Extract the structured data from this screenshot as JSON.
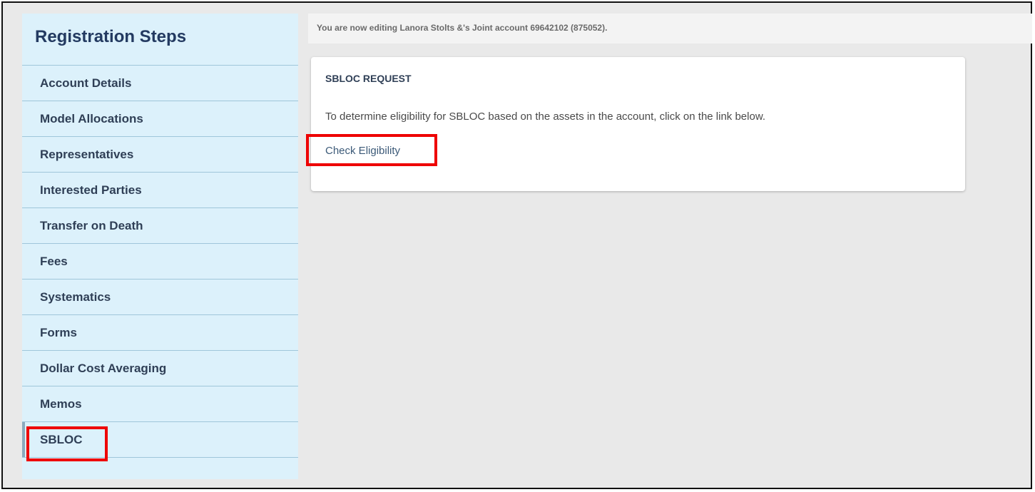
{
  "sidebar": {
    "title": "Registration Steps",
    "steps": [
      {
        "label": "Account Details"
      },
      {
        "label": "Model Allocations"
      },
      {
        "label": "Representatives"
      },
      {
        "label": "Interested Parties"
      },
      {
        "label": "Transfer on Death"
      },
      {
        "label": "Fees"
      },
      {
        "label": "Systematics"
      },
      {
        "label": "Forms"
      },
      {
        "label": "Dollar Cost Averaging"
      },
      {
        "label": "Memos"
      },
      {
        "label": "SBLOC"
      }
    ],
    "active_step": "SBLOC"
  },
  "notice": {
    "text": "You are now editing Lanora Stolts &'s Joint account 69642102 (875052)."
  },
  "card": {
    "title": "SBLOC REQUEST",
    "description": "To determine eligibility for SBLOC based on the assets in the account, click on the link below.",
    "link_label": "Check Eligibility"
  },
  "colors": {
    "sidebar_bg": "#dcf1fb",
    "highlight": "#ee0000",
    "title": "#233a61"
  }
}
